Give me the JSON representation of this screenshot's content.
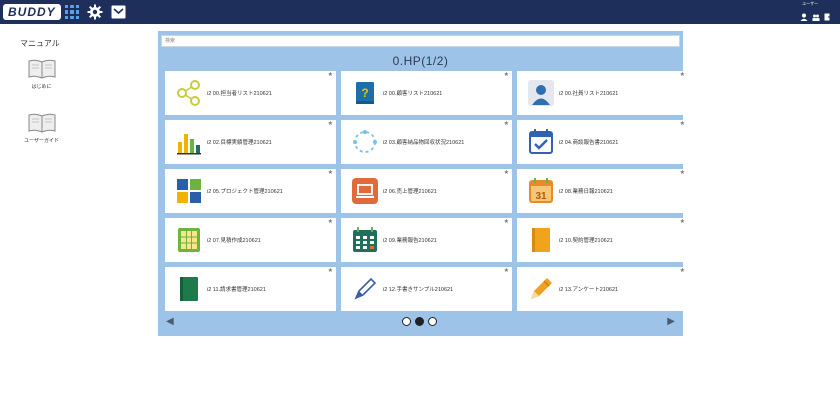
{
  "app": {
    "logo_text": "BUDDY"
  },
  "topbar": {
    "user_name": "ユーザー"
  },
  "sidebar": {
    "title": "マニュアル",
    "items": [
      {
        "label": "はじめに",
        "icon": "book-open-icon"
      },
      {
        "label": "ユーザーガイド",
        "icon": "book-open-icon"
      }
    ]
  },
  "panel": {
    "search_placeholder": "検索",
    "title": "0.HP(1/2)",
    "tiles": [
      {
        "label": "i2 00.担当者リスト210621",
        "icon": "share-nodes-icon",
        "color": "#c8cc3c"
      },
      {
        "label": "i2 00.顧客リスト210621",
        "icon": "book-question-icon",
        "color": "#1c6fa8"
      },
      {
        "label": "i2 00.社員リスト210621",
        "icon": "person-icon",
        "color": "#2f6fb0"
      },
      {
        "label": "i2 02.目標実績管理210621",
        "icon": "bar-chart-icon",
        "color": "#f0b400"
      },
      {
        "label": "i2 03.顧客納品物回収状況210621",
        "icon": "dotted-cycle-icon",
        "color": "#7ac0e8"
      },
      {
        "label": "i2 04.商談報告書210621",
        "icon": "calendar-check-icon",
        "color": "#2f62b0"
      },
      {
        "label": "i2 05.プロジェクト管理210621",
        "icon": "windows-tiles-icon",
        "color": "#2a5ea8"
      },
      {
        "label": "i2 06.売上管理210621",
        "icon": "laptop-icon",
        "color": "#e06a3a"
      },
      {
        "label": "i2 08.業務日報210621",
        "icon": "calendar-31-icon",
        "color": "#e78a2a"
      },
      {
        "label": "i2 07.見積作成210621",
        "icon": "calculator-icon",
        "color": "#6db33f"
      },
      {
        "label": "i2 09.業務報告210621",
        "icon": "calendar-grid-icon",
        "color": "#1f6f5a"
      },
      {
        "label": "i2 10.契約管理210621",
        "icon": "orange-book-icon",
        "color": "#f2a31e"
      },
      {
        "label": "i2 11.請求書管理210621",
        "icon": "green-book-icon",
        "color": "#1e7a4a"
      },
      {
        "label": "i2 12.手書きサンプル210621",
        "icon": "pen-outline-icon",
        "color": "#3a5ea8"
      },
      {
        "label": "i2 13.アンケート210621",
        "icon": "pencil-icon",
        "color": "#f0a020"
      }
    ],
    "pager": {
      "pages": 3,
      "current": 2
    }
  },
  "colors": {
    "topbar": "#1e2f5c",
    "panel": "#9ec3e8",
    "accent": "#5aa0e6"
  }
}
